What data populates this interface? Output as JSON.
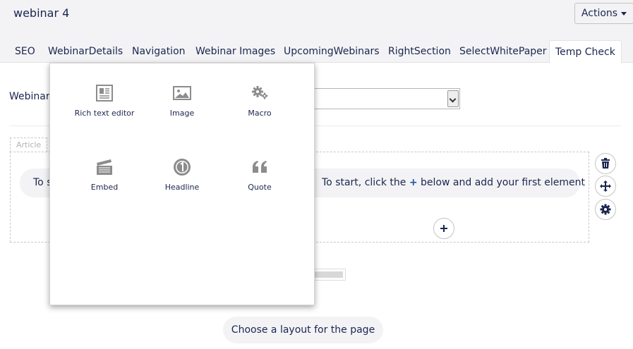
{
  "page": {
    "title": "webinar 4"
  },
  "actions": {
    "label": "Actions"
  },
  "tabs": [
    {
      "label": "SEO",
      "active": false
    },
    {
      "label": "WebinarDetails",
      "active": false
    },
    {
      "label": "Navigation",
      "active": false
    },
    {
      "label": "Webinar Images",
      "active": false
    },
    {
      "label": "UpcomingWebinars",
      "active": false
    },
    {
      "label": "RightSection",
      "active": false
    },
    {
      "label": "SelectWhitePaper",
      "active": false
    },
    {
      "label": "Temp Check",
      "active": true
    }
  ],
  "form": {
    "field_label": "Webinar",
    "select_value": ""
  },
  "editor": {
    "article_tag": "Article",
    "hint_left": "To s",
    "hint_right_before": "To start, click the",
    "hint_plus": "+",
    "hint_right_after": "below and add your first element"
  },
  "sidebar_controls": {
    "delete_icon": "trash-icon",
    "move_icon": "move-icon",
    "settings_icon": "gear-icon"
  },
  "layout": {
    "label": "Choose a layout for the page"
  },
  "popup": {
    "items": [
      {
        "label": "Rich text editor",
        "icon": "rich-text-editor-icon"
      },
      {
        "label": "Image",
        "icon": "image-icon"
      },
      {
        "label": "Macro",
        "icon": "macro-icon"
      },
      {
        "label": "Embed",
        "icon": "embed-icon"
      },
      {
        "label": "Headline",
        "icon": "headline-icon"
      },
      {
        "label": "Quote",
        "icon": "quote-icon"
      }
    ]
  },
  "colors": {
    "text": "#1b264f",
    "accent": "#2152a3",
    "header_bg": "#f3f3f5",
    "icon_gray": "#8c8c8c"
  }
}
